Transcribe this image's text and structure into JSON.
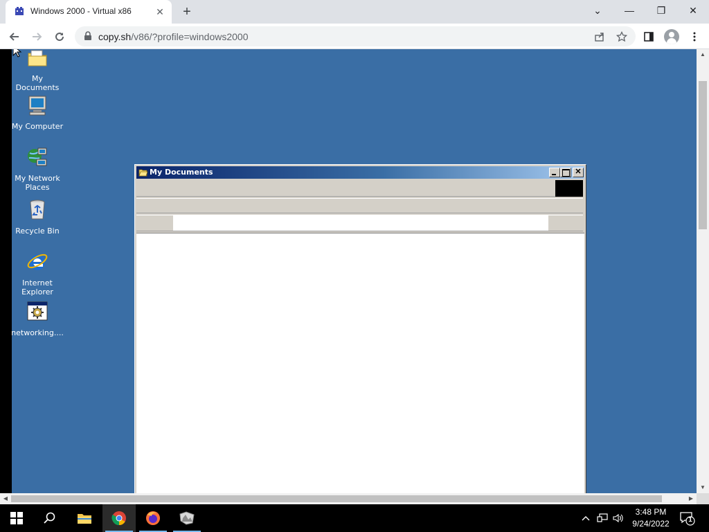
{
  "browser": {
    "tab_title": "Windows 2000 - Virtual x86",
    "tab_close": "✕",
    "new_tab": "+",
    "window_controls": {
      "chevron": "⌄",
      "minimize": "—",
      "restore": "❐",
      "close": "✕"
    },
    "url_host": "copy.sh",
    "url_path": "/v86/?profile=windows2000",
    "icons": [
      "back-icon",
      "forward-icon",
      "reload-icon",
      "lock-icon",
      "share-icon",
      "star-icon",
      "side-panel-icon",
      "profile-icon",
      "menu-icon"
    ]
  },
  "desktop": {
    "background": "#3a6ea5",
    "icons": [
      {
        "label": "My Documents"
      },
      {
        "label": "My Computer"
      },
      {
        "label": "My Network Places"
      },
      {
        "label": "Recycle Bin"
      },
      {
        "label": "Internet Explorer"
      },
      {
        "label": "networking...."
      }
    ]
  },
  "window": {
    "title": "My Documents",
    "title_gradient": [
      "#0a246a",
      "#a6caf0"
    ],
    "close_glyph": "✕"
  },
  "taskbar": {
    "time": "3:48 PM",
    "date": "9/24/2022",
    "notification_count": "1",
    "apps": [
      "file-explorer-icon",
      "chrome-icon",
      "firefox-icon",
      "paint-icon"
    ],
    "accent": "#76b9ed"
  }
}
